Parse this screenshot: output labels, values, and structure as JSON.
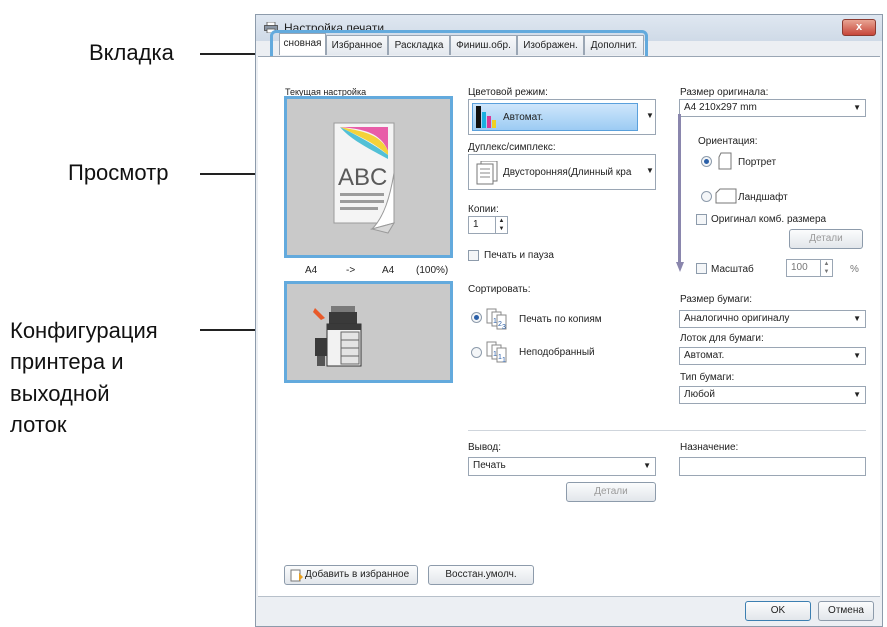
{
  "callouts": {
    "tab": "Вкладка",
    "preview": "Просмотр",
    "config_line1": "Конфигурация",
    "config_line2": "принтера и",
    "config_line3": "выходной",
    "config_line4": "лоток"
  },
  "window": {
    "title": "Настройка печати",
    "close": "x"
  },
  "tabs": [
    "сновная",
    "Избранное",
    "Раскладка",
    "Финиш.обр.",
    "Изображен.",
    "Дополнит."
  ],
  "left": {
    "current_setting_label": "Текущая настройка",
    "preview_abc": "ABC",
    "size_from": "A4",
    "size_arrow": "->",
    "size_to": "A4",
    "size_pct": "(100%)"
  },
  "middle": {
    "color_mode_label": "Цветовой режим:",
    "color_mode_value": "Автомат.",
    "duplex_label": "Дуплекс/симплекс:",
    "duplex_value": "Двусторонняя(Длинный кра",
    "copies_label": "Копии:",
    "copies_value": "1",
    "print_pause_label": "Печать и пауза",
    "sort_label": "Сортировать:",
    "sort_option1": "Печать по копиям",
    "sort_option2": "Неподобранный",
    "output_label": "Вывод:",
    "output_value": "Печать",
    "details_button": "Детали"
  },
  "right": {
    "orig_size_label": "Размер оригинала:",
    "orig_size_value": "A4 210x297 mm",
    "orientation_label": "Ориентация:",
    "portrait": "Портрет",
    "landscape": "Ландшафт",
    "mixed_size": "Оригинал комб. размера",
    "details_button": "Детали",
    "scale_label": "Масштаб",
    "scale_value": "100",
    "scale_unit": "%",
    "paper_size_label": "Размер бумаги:",
    "paper_size_value": "Аналогично оригиналу",
    "tray_label": "Лоток для бумаги:",
    "tray_value": "Автомат.",
    "paper_type_label": "Тип бумаги:",
    "paper_type_value": "Любой",
    "destination_label": "Назначение:",
    "destination_value": ""
  },
  "bottom": {
    "add_favorite": "Добавить в избранное",
    "restore_default": "Восстан.умолч.",
    "ok": "OK",
    "cancel": "Отмена"
  }
}
